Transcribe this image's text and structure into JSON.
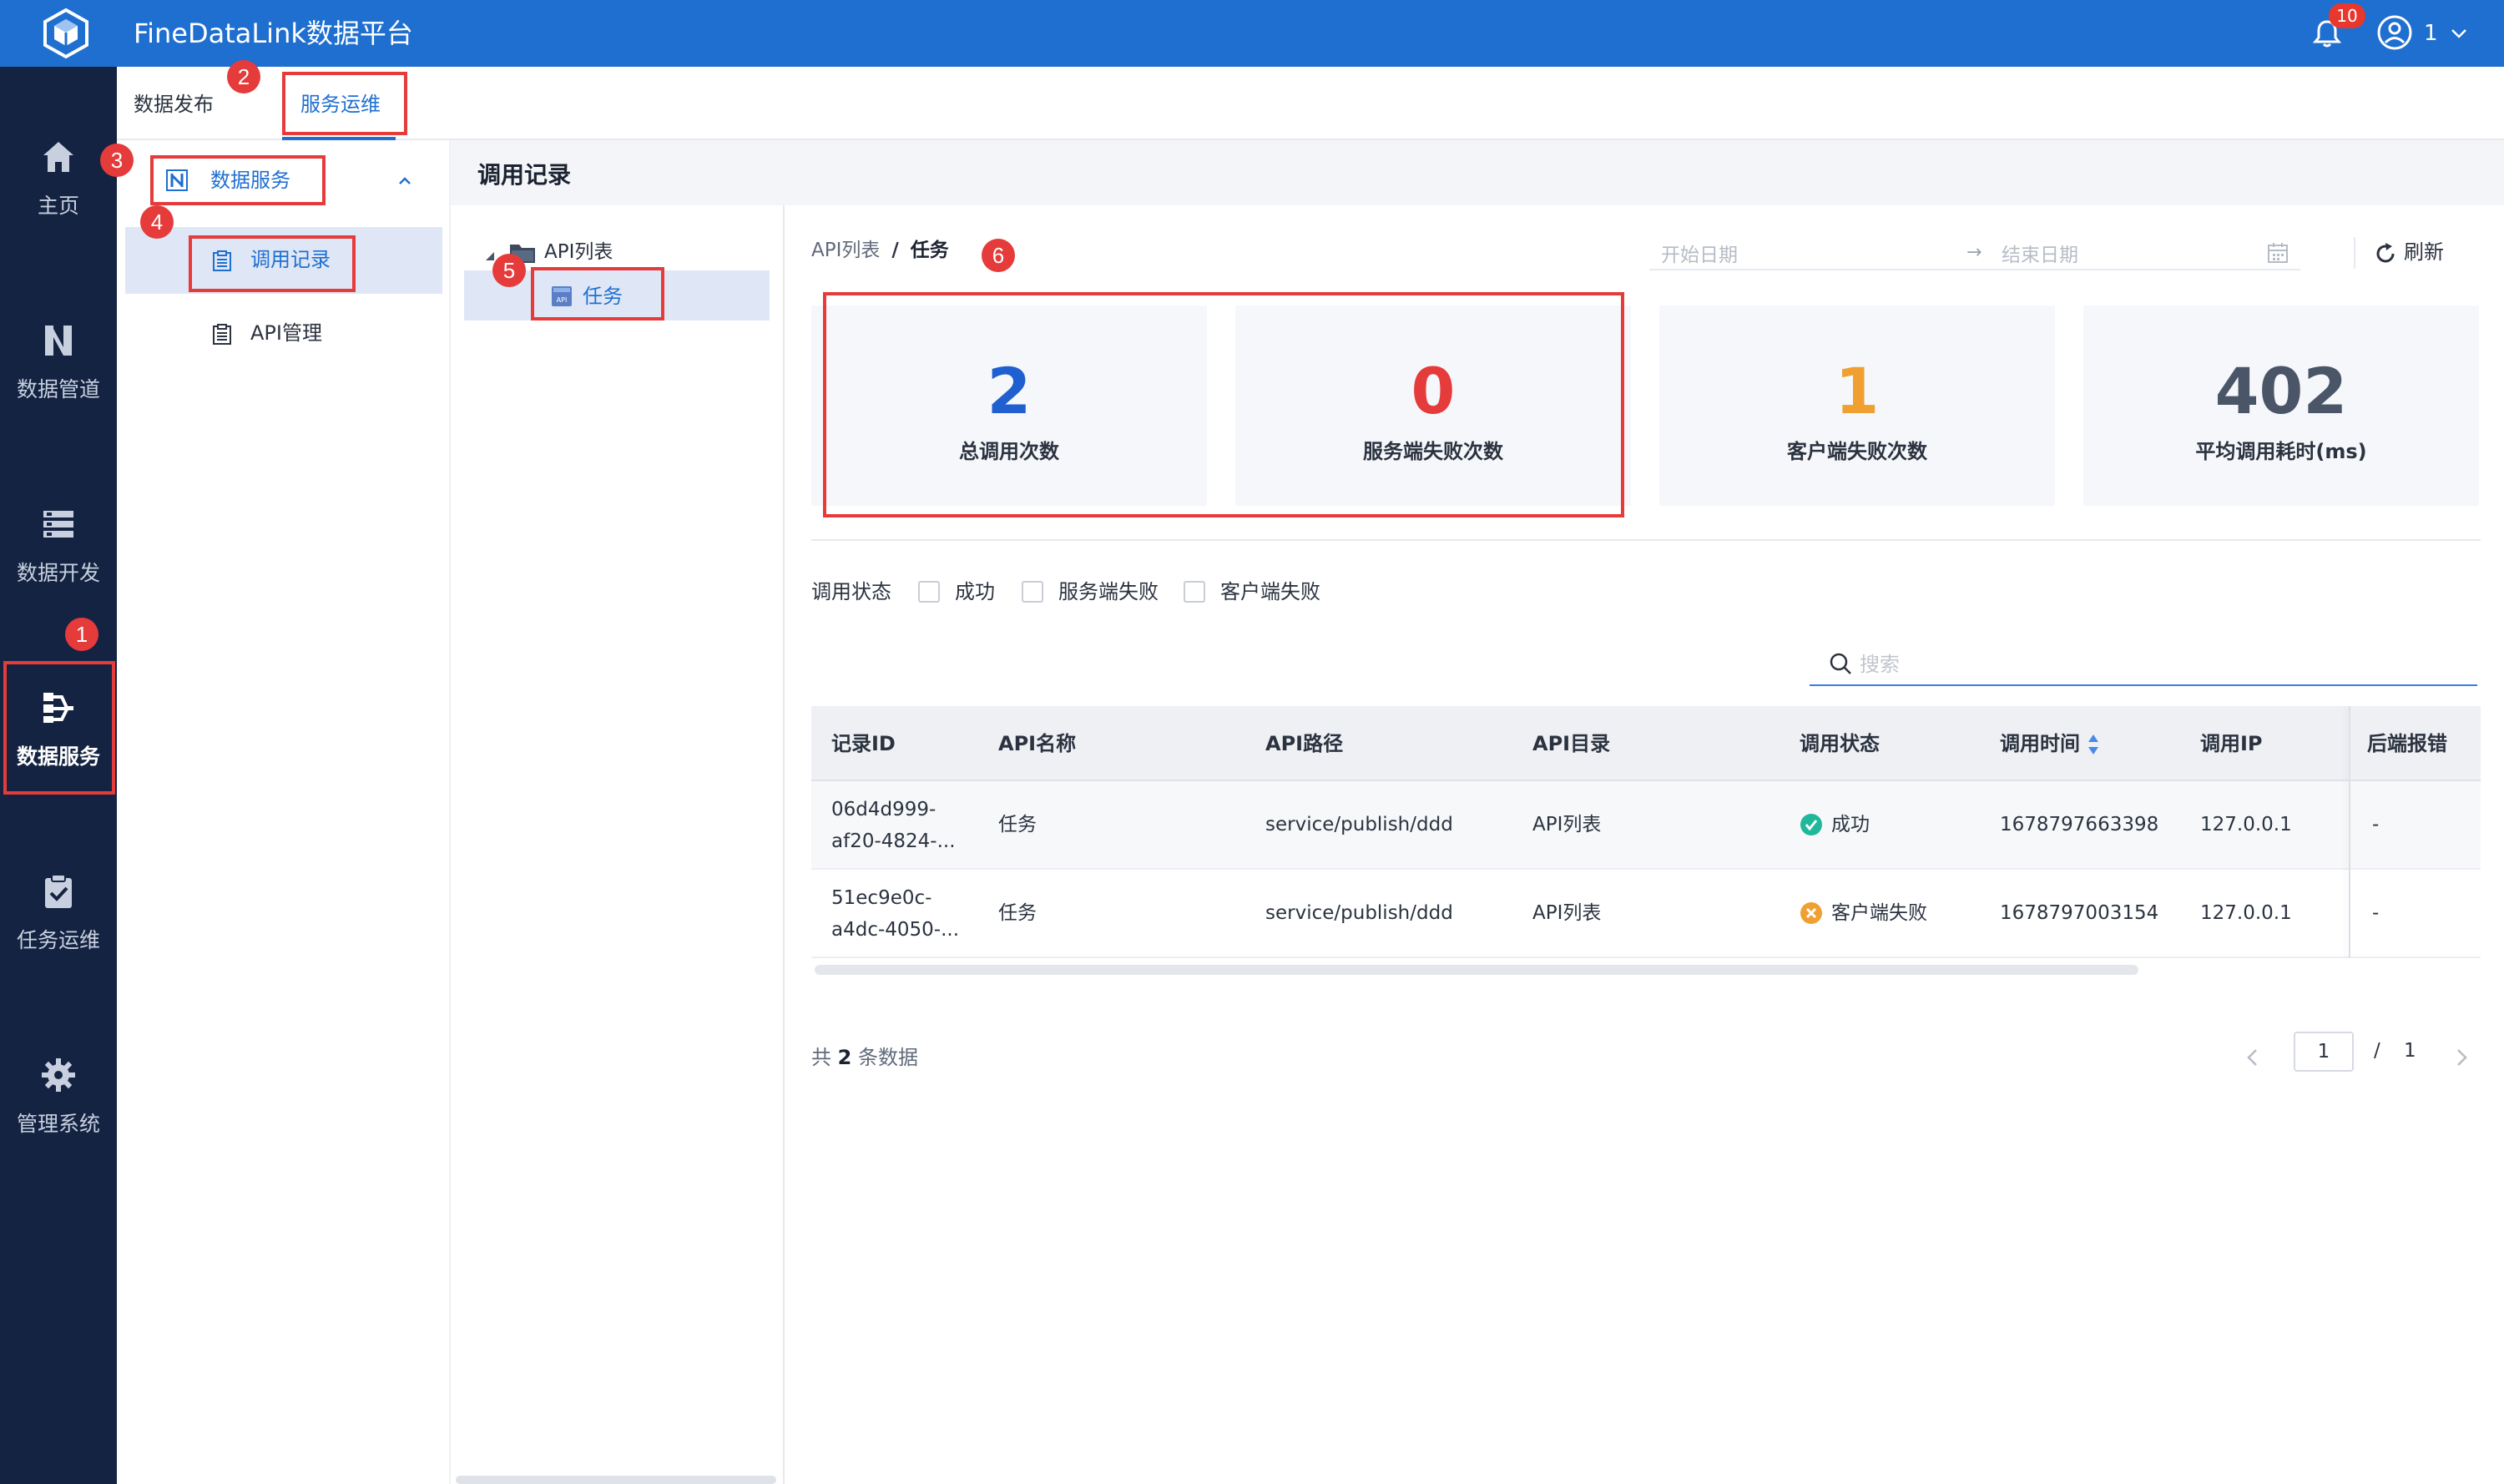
{
  "header": {
    "app_title": "FineDataLink数据平台",
    "notification_count": "10",
    "user_name": "1"
  },
  "left_nav": {
    "items": [
      {
        "label": "主页",
        "icon": "home-icon"
      },
      {
        "label": "数据管道",
        "icon": "pipeline-icon"
      },
      {
        "label": "数据开发",
        "icon": "dev-icon"
      },
      {
        "label": "数据服务",
        "icon": "data-service-icon",
        "active": true
      },
      {
        "label": "任务运维",
        "icon": "task-ops-icon"
      },
      {
        "label": "管理系统",
        "icon": "gear-icon"
      }
    ]
  },
  "tabs": [
    {
      "label": "数据发布"
    },
    {
      "label": "服务运维",
      "active": true
    }
  ],
  "sub_sidebar": {
    "group_label": "数据服务",
    "items": [
      {
        "label": "调用记录",
        "active": true
      },
      {
        "label": "API管理"
      }
    ]
  },
  "page": {
    "title": "调用记录"
  },
  "tree": {
    "root_label": "API列表",
    "leaf_label": "任务"
  },
  "breadcrumb": {
    "parent": "API列表",
    "separator": "/",
    "current": "任务"
  },
  "date_range": {
    "start_placeholder": "开始日期",
    "arrow": "→",
    "end_placeholder": "结束日期"
  },
  "refresh_label": "刷新",
  "stats": [
    {
      "value": "2",
      "label": "总调用次数",
      "color": "#1f5fcf"
    },
    {
      "value": "0",
      "label": "服务端失败次数",
      "color": "#e53b3b"
    },
    {
      "value": "1",
      "label": "客户端失败次数",
      "color": "#f0a030"
    },
    {
      "value": "402",
      "label": "平均调用耗时(ms)",
      "color": "#4a5568"
    }
  ],
  "filters": {
    "label": "调用状态",
    "options": [
      "成功",
      "服务端失败",
      "客户端失败"
    ]
  },
  "search": {
    "placeholder": "搜索",
    "value": ""
  },
  "table": {
    "columns": [
      "记录ID",
      "API名称",
      "API路径",
      "API目录",
      "调用状态",
      "调用时间",
      "调用IP",
      "后端报错"
    ],
    "rows": [
      {
        "id_line1": "06d4d999-",
        "id_line2": "af20-4824-...",
        "api_name": "任务",
        "api_path": "service/publish/ddd",
        "api_dir": "API列表",
        "status": "成功",
        "status_type": "success",
        "time": "1678797663398",
        "ip": "127.0.0.1",
        "error": "-"
      },
      {
        "id_line1": "51ec9e0c-",
        "id_line2": "a4dc-4050-...",
        "api_name": "任务",
        "api_path": "service/publish/ddd",
        "api_dir": "API列表",
        "status": "客户端失败",
        "status_type": "client-fail",
        "time": "1678797003154",
        "ip": "127.0.0.1",
        "error": "-"
      }
    ]
  },
  "footer": {
    "total_prefix": "共",
    "total_count": "2",
    "total_suffix": "条数据",
    "current_page": "1",
    "page_sep": "/",
    "total_pages": "1"
  },
  "annotations": [
    "1",
    "2",
    "3",
    "4",
    "5",
    "6"
  ],
  "colors": {
    "brand_blue": "#1f6fd0",
    "nav_dark": "#142341",
    "annotation_red": "#e53b3b",
    "success_green": "#1fb89a",
    "warn_orange": "#f0a030"
  }
}
